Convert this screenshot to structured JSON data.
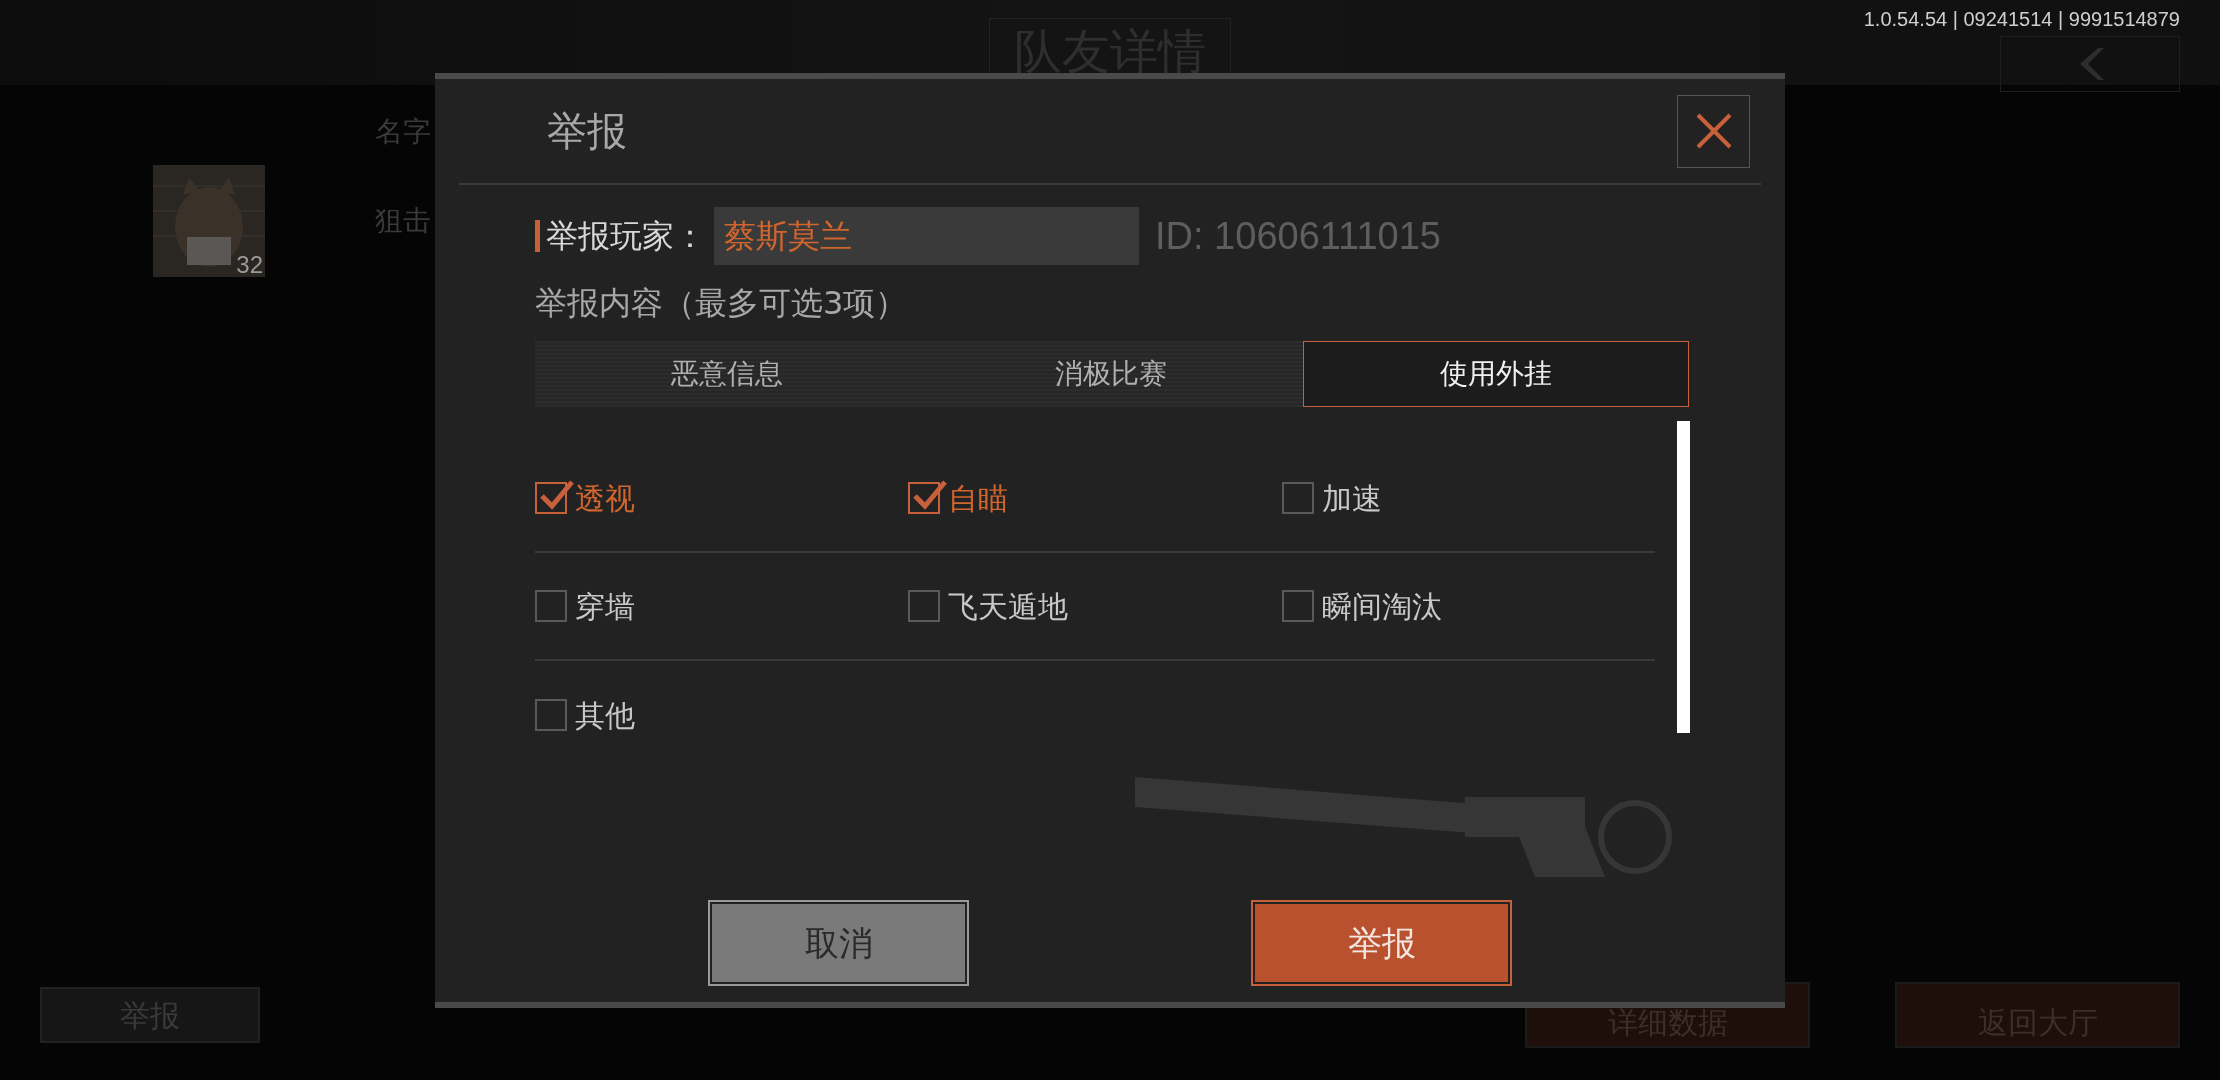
{
  "background_page": {
    "title": "队友详情",
    "version": "1.0.54.54 | 09241514 | 9991514879",
    "name_label": "名字",
    "mode_label": "狙击",
    "avatar_level": "32",
    "buttons": [
      {
        "label": "举报",
        "kind": "dark"
      },
      {
        "label": "详细数据",
        "kind": "red"
      },
      {
        "label": "返回大厅",
        "kind": "red"
      }
    ]
  },
  "dialog": {
    "title": "举报",
    "player_label": "举报玩家：",
    "player_name": "蔡斯莫兰",
    "player_id": "ID: 10606111015",
    "content_label": "举报内容（最多可选3项）",
    "tabs": [
      {
        "label": "恶意信息",
        "selected": false
      },
      {
        "label": "消极比赛",
        "selected": false
      },
      {
        "label": "使用外挂",
        "selected": true
      }
    ],
    "options": [
      {
        "label": "透视",
        "checked": true
      },
      {
        "label": "自瞄",
        "checked": true
      },
      {
        "label": "加速",
        "checked": false
      },
      {
        "label": "穿墙",
        "checked": false
      },
      {
        "label": "飞天遁地",
        "checked": false
      },
      {
        "label": "瞬间淘汰",
        "checked": false
      },
      {
        "label": "其他",
        "checked": false
      }
    ],
    "buttons": [
      {
        "label": "取消",
        "kind": "cancel"
      },
      {
        "label": "举报",
        "kind": "confirm"
      }
    ]
  }
}
